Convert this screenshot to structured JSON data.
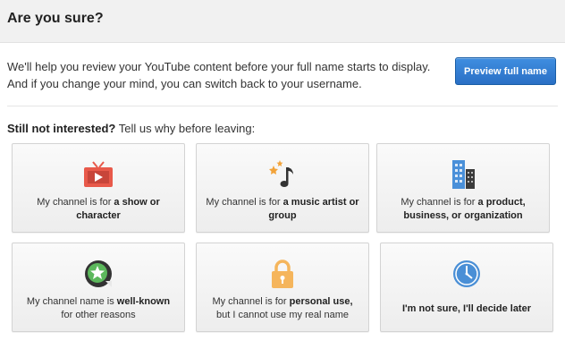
{
  "header": {
    "title": "Are you sure?"
  },
  "intro": {
    "line1": "We'll help you review your YouTube content before your full name starts to display.",
    "line2": "And if you change your mind, you can switch back to your username."
  },
  "preview_button": {
    "label": "Preview full name"
  },
  "reasons_heading": {
    "bold": "Still not interested?",
    "rest": " Tell us why before leaving:"
  },
  "cards": [
    {
      "icon": "tv-icon",
      "pre": "My channel is for ",
      "bold": "a show or character",
      "post": ""
    },
    {
      "icon": "music-note-icon",
      "pre": "My channel is for ",
      "bold": "a music artist or group",
      "post": ""
    },
    {
      "icon": "buildings-icon",
      "pre": "My channel is for ",
      "bold": "a product, business, or organization",
      "post": ""
    },
    {
      "icon": "star-badge-icon",
      "pre": "My channel name is ",
      "bold": "well-known",
      "post": " for other reasons"
    },
    {
      "icon": "lock-icon",
      "pre": "My channel is for ",
      "bold": "personal use,",
      "post": " but I cannot use my real name"
    },
    {
      "icon": "clock-icon",
      "pre": "",
      "bold": "I'm not sure, I'll decide later",
      "post": ""
    }
  ],
  "colors": {
    "accent_blue": "#2a6fc5",
    "tv_red": "#e8594a",
    "star_orange": "#f2a33a",
    "building_blue": "#4a90d9",
    "badge_green": "#5cb85c",
    "lock_orange": "#f5b55c",
    "clock_blue": "#4a8fd6"
  }
}
